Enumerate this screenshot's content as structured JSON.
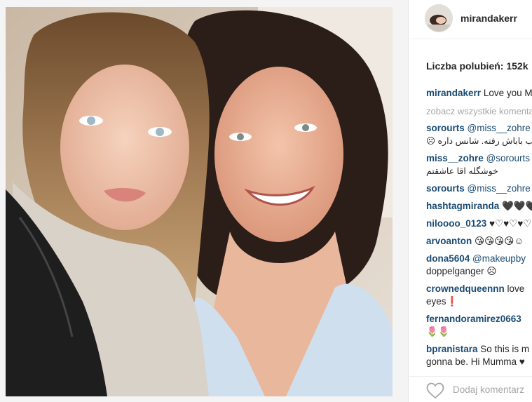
{
  "post": {
    "username": "mirandakerr",
    "likes_text": "Liczba polubień: 152k",
    "add_comment_placeholder": "Dodaj komentarz",
    "see_all_text": "zobacz wszystkie komentarze"
  },
  "comments": [
    {
      "user": "mirandakerr",
      "text": "Love you Mumma"
    },
    {
      "user": "sorourts",
      "text": "@miss__zohre",
      "line2": "ب باباش رفته. شانس داره ☹"
    },
    {
      "user": "miss__zohre",
      "text": "@sorourts",
      "line2": "خوشگله اقا عاشقتم"
    },
    {
      "user": "sorourts",
      "text": "@miss__zohre"
    },
    {
      "user": "hashtagmiranda",
      "text": "🖤🖤🖤"
    },
    {
      "user": "niloooo_0123",
      "text": "♥♡♥♡♥♡"
    },
    {
      "user": "arvoanton",
      "text": "😘😘😘😘☺"
    },
    {
      "user": "dona5604",
      "text": "@makeupby",
      "line2": "doppelganger ☹"
    },
    {
      "user": "crownedqueennn",
      "text": "love",
      "line2": "eyes❗"
    },
    {
      "user": "fernandoramirez0663",
      "text": "",
      "line2": "🌷🌷"
    },
    {
      "user": "bpranistara",
      "text": "So this is m",
      "line2": "gonna be. Hi Mumma ♥"
    }
  ],
  "colors": {
    "username_blue": "#1a4b73",
    "muted_gray": "#a6a6a6",
    "border": "#efefef"
  },
  "icons": [
    "heart-icon"
  ]
}
